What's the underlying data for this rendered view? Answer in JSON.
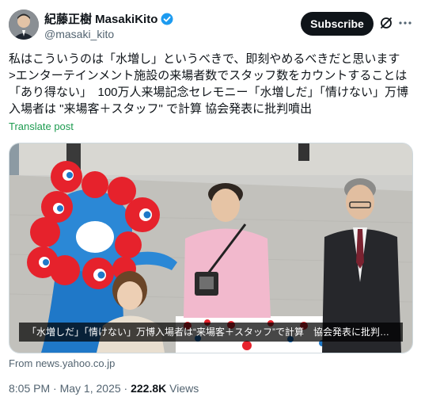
{
  "author": {
    "display_name": "紀藤正樹 MasakiKito",
    "handle": "@masaki_kito"
  },
  "actions": {
    "subscribe_label": "Subscribe"
  },
  "post": {
    "text": "私はこういうのは「水増し」というべきで、即刻やめるべきだと思います\n>エンターテインメント施設の来場者数でスタッフ数をカウントすることは「あり得ない」　100万人来場記念セレモニー「水増しだ」「情けない」万博入場者は \"来場客＋スタッフ\" で計算 協会発表に批判噴出",
    "translate_label": "Translate post"
  },
  "media": {
    "caption": "「水増しだ」「情けない」万博入場者は“来場客＋スタッフ”で計算　協会発表に批判…",
    "source": "From news.yahoo.co.jp"
  },
  "meta": {
    "time": "8:05 PM",
    "separator": " · ",
    "date": "May 1, 2025",
    "views_count": "222.8K",
    "views_label": " Views"
  },
  "colors": {
    "verified": "#1d9bf0",
    "translate": "#1d9b50",
    "mascot_red": "#e6222c",
    "mascot_blue": "#1f78c8"
  },
  "icons": [
    "verified-badge-icon",
    "grok-icon",
    "more-options-icon"
  ]
}
